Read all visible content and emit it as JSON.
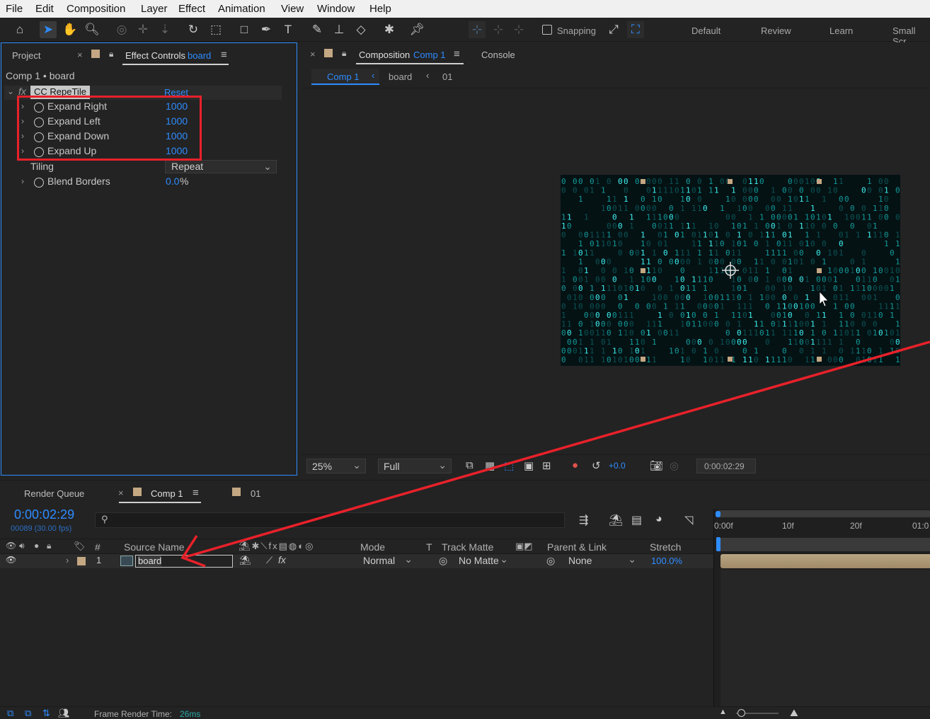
{
  "menu": [
    "File",
    "Edit",
    "Composition",
    "Layer",
    "Effect",
    "Animation",
    "View",
    "Window",
    "Help"
  ],
  "toolbar": {
    "snapping_label": "Snapping",
    "workspaces": [
      "Default",
      "Review",
      "Learn",
      "Small Scr"
    ]
  },
  "left_panel": {
    "tab_project": "Project",
    "tab_effect_controls": "Effect Controls",
    "tab_effect_controls_layer": "board",
    "breadcrumb": "Comp 1 • board",
    "effect_name": "CC RepeTile",
    "reset_label": "Reset",
    "properties": [
      {
        "name": "Expand Right",
        "value": "1000"
      },
      {
        "name": "Expand Left",
        "value": "1000"
      },
      {
        "name": "Expand Down",
        "value": "1000"
      },
      {
        "name": "Expand Up",
        "value": "1000"
      }
    ],
    "tiling_label": "Tiling",
    "tiling_value": "Repeat",
    "blend_label": "Blend Borders",
    "blend_value": "0.0",
    "blend_unit": "%"
  },
  "comp_panel": {
    "tab_composition": "Composition",
    "tab_comp_name": "Comp 1",
    "tab_console": "Console",
    "crumb_comp": "Comp 1",
    "crumb_layer": "board",
    "crumb_01": "01",
    "zoom": "25%",
    "resolution": "Full",
    "exposure": "+0.0",
    "timecode": "0:00:02:29"
  },
  "timeline": {
    "tab_render_queue": "Render Queue",
    "tab_comp": "Comp 1",
    "tab_01": "01",
    "current_time": "0:00:02:29",
    "frame_info": "00089 (30.00 fps)",
    "col_hash": "#",
    "col_source": "Source Name",
    "col_mode": "Mode",
    "col_t": "T",
    "col_track_matte": "Track Matte",
    "col_parent": "Parent & Link",
    "col_stretch": "Stretch",
    "ruler": [
      "0:00f",
      "10f",
      "20f",
      "01:0"
    ],
    "layer": {
      "index": "1",
      "name": "board",
      "mode": "Normal",
      "track_matte": "No Matte",
      "parent": "None",
      "stretch": "100.0%"
    },
    "frame_render_label": "Frame Render Time:",
    "frame_render_value": "26ms"
  },
  "colors": {
    "accent_blue": "#2e8cff",
    "annotation_red": "#e8212a",
    "matrix_cyan": "#1fd4d4"
  }
}
